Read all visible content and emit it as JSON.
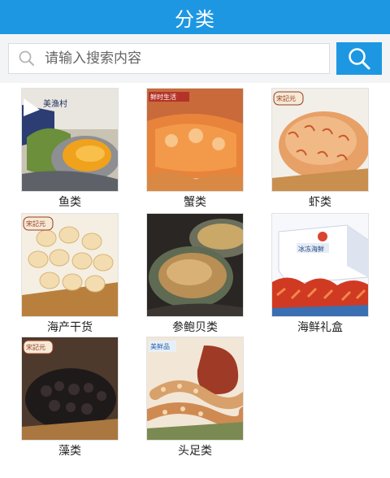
{
  "header": {
    "title": "分类"
  },
  "search": {
    "placeholder": "请输入搜索内容"
  },
  "categories": [
    {
      "label": "鱼类",
      "badge": "美渔村"
    },
    {
      "label": "蟹类",
      "badge": "鲜时生活"
    },
    {
      "label": "虾类",
      "badge": "宋記元"
    },
    {
      "label": "海产干货",
      "badge": "宋記元"
    },
    {
      "label": "参鲍贝类",
      "badge": ""
    },
    {
      "label": "海鲜礼盒",
      "badge": "冰冻海鲜"
    },
    {
      "label": "藻类",
      "badge": "宋記元"
    },
    {
      "label": "头足类",
      "badge": "美鲜品"
    }
  ],
  "colors": {
    "accent": "#1d97e2",
    "search_bg": "#f2f4f6"
  }
}
